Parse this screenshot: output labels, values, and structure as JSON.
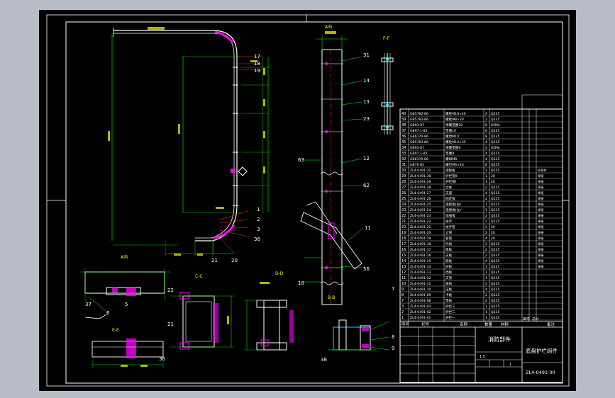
{
  "colors": {
    "outer_bg": "#b8bcc6",
    "paper": "#000000",
    "frame": "#ffffff",
    "drawing_line": "#ffffff",
    "dim_line": "#00ff00",
    "label_yellow": "#ffff00",
    "accent_green": "#00ff66",
    "magenta": "#ff00ff",
    "cyan": "#00ffff",
    "red": "#ff3333"
  },
  "callouts_left": [
    "17",
    "18",
    "19",
    "1",
    "2",
    "3",
    "36",
    "20",
    "21"
  ],
  "callouts_right": [
    "31",
    "14",
    "13",
    "23",
    "12",
    "62",
    "11",
    "56",
    "63",
    "18"
  ],
  "callouts_bottom": [
    "37",
    "6",
    "5",
    "22",
    "21",
    "36",
    "7",
    "8",
    "9",
    "38"
  ],
  "view_labels": [
    "A向",
    "B-B",
    "C-C",
    "D-D",
    "E-E",
    "F-F",
    "A向"
  ],
  "section_title": "消防部件",
  "title_block": {
    "drawing_name": "底盘护栏组件",
    "drawing_no": "ZL4-0491-00",
    "scale": "1:5",
    "sheet": "1",
    "headers": [
      "序号",
      "代号",
      "名称",
      "数量",
      "材料",
      "单件",
      "总计",
      "备注"
    ]
  },
  "bom_rows": [
    [
      "40",
      "GB5782-86",
      "螺栓M10×40",
      "4",
      "Q235",
      ""
    ],
    [
      "39",
      "GB5782-86",
      "螺栓M8×30",
      "2",
      "Q235",
      ""
    ],
    [
      "38",
      "GB93-87",
      "弹簧垫圈10",
      "8",
      "65Mn",
      ""
    ],
    [
      "37",
      "GB97.1-85",
      "垫圈10",
      "8",
      "Q235",
      ""
    ],
    [
      "36",
      "GB6170-86",
      "螺母M10",
      "8",
      "Q235",
      ""
    ],
    [
      "35",
      "GB5783-86",
      "螺栓M10×35",
      "4",
      "Q235",
      ""
    ],
    [
      "34",
      "GB93-87",
      "弹簧垫圈8",
      "4",
      "65Mn",
      ""
    ],
    [
      "33",
      "GB97.1-85",
      "垫圈8",
      "4",
      "Q235",
      ""
    ],
    [
      "32",
      "GB6170-86",
      "螺母M8",
      "4",
      "Q235",
      ""
    ],
    [
      "31",
      "GB70-85",
      "螺钉M6×16",
      "6",
      "Q235",
      ""
    ],
    [
      "30",
      "ZL4-0491-31",
      "连接板",
      "2",
      "Q235",
      "外购件"
    ],
    [
      "29",
      "ZL4-0491-30",
      "护栏管Ⅱ",
      "1",
      "20",
      "焊接"
    ],
    [
      "28",
      "ZL4-0491-29",
      "护栏管Ⅰ",
      "1",
      "20",
      "焊接"
    ],
    [
      "27",
      "ZL4-0491-28",
      "立柱",
      "2",
      "Q235",
      "焊接"
    ],
    [
      "26",
      "ZL4-0491-27",
      "支座",
      "4",
      "Q235",
      "焊接"
    ],
    [
      "25",
      "ZL4-0491-26",
      "固定板",
      "2",
      "Q235",
      "焊接"
    ],
    [
      "24",
      "ZL4-0491-25",
      "连接板(右)",
      "1",
      "Q235",
      "焊接"
    ],
    [
      "23",
      "ZL4-0491-24",
      "连接板(左)",
      "1",
      "Q235",
      "焊接"
    ],
    [
      "22",
      "ZL4-0491-23",
      "加强板",
      "2",
      "Q235",
      "焊接"
    ],
    [
      "21",
      "ZL4-0491-22",
      "扶手",
      "1",
      "Q235",
      "焊接"
    ],
    [
      "20",
      "ZL4-0491-21",
      "扶手管",
      "2",
      "20",
      "焊接"
    ],
    [
      "19",
      "ZL4-0491-20",
      "立管",
      "2",
      "20",
      "焊接"
    ],
    [
      "18",
      "ZL4-0491-19",
      "套管",
      "4",
      "20",
      "焊接"
    ],
    [
      "17",
      "ZL4-0491-18",
      "托板",
      "2",
      "Q235",
      "焊接"
    ],
    [
      "16",
      "ZL4-0491-17",
      "底板",
      "2",
      "Q235",
      "焊接"
    ],
    [
      "15",
      "ZL4-0491-16",
      "支板",
      "2",
      "Q235",
      "焊接"
    ],
    [
      "14",
      "ZL4-0491-15",
      "筋板",
      "4",
      "Q235",
      "焊接"
    ],
    [
      "13",
      "ZL4-0491-14",
      "护板",
      "1",
      "Q235",
      "焊接"
    ],
    [
      "12",
      "ZL4-0491-13",
      "挡板",
      "2",
      "Q235",
      ""
    ],
    [
      "11",
      "ZL4-0491-12",
      "支架",
      "1",
      "Q235",
      ""
    ],
    [
      "10",
      "ZL4-0491-11",
      "盖板",
      "2",
      "Q235",
      ""
    ],
    [
      "9",
      "ZL4-0491-10",
      "压板",
      "4",
      "Q235",
      ""
    ],
    [
      "8",
      "ZL4-0491-09",
      "卡板",
      "2",
      "Q235",
      ""
    ],
    [
      "7",
      "ZL4-0491-08",
      "垫板",
      "4",
      "Q235",
      ""
    ],
    [
      "3",
      "ZL4-0491-03",
      "护栏三",
      "1",
      "Q235",
      ""
    ],
    [
      "2",
      "ZL4-0491-02",
      "护栏二",
      "1",
      "Q235",
      ""
    ],
    [
      "1",
      "ZL4-0491-01",
      "护栏一",
      "1",
      "Q235",
      ""
    ]
  ]
}
